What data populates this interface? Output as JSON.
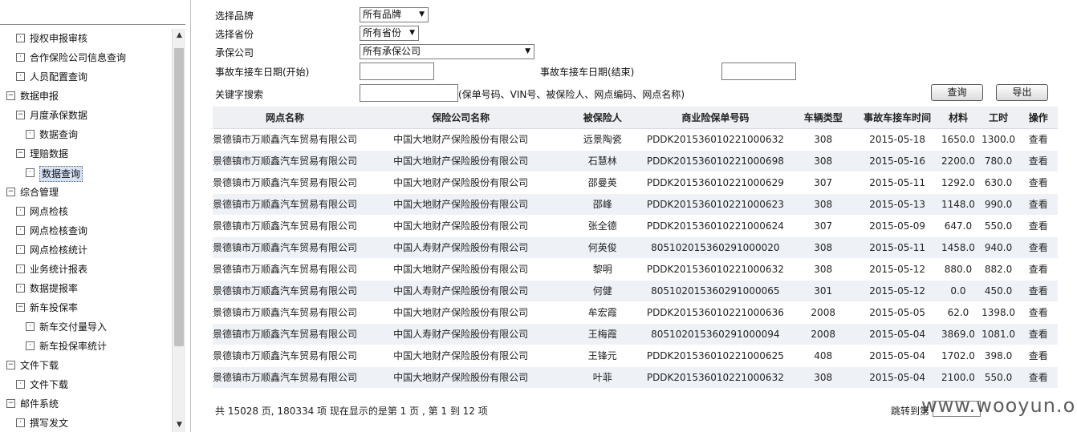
{
  "tree": [
    {
      "label": "授权申报审核",
      "level": 2,
      "type": "leaf"
    },
    {
      "label": "合作保险公司信息查询",
      "level": 2,
      "type": "leaf"
    },
    {
      "label": "人员配置查询",
      "level": 2,
      "type": "leaf"
    },
    {
      "label": "数据申报",
      "level": 1,
      "type": "open"
    },
    {
      "label": "月度承保数据",
      "level": 2,
      "type": "open"
    },
    {
      "label": "数据查询",
      "level": 3,
      "type": "leaf"
    },
    {
      "label": "理赔数据",
      "level": 2,
      "type": "open"
    },
    {
      "label": "数据查询",
      "level": 3,
      "type": "leaf",
      "selected": true
    },
    {
      "label": "综合管理",
      "level": 1,
      "type": "open"
    },
    {
      "label": "网点检核",
      "level": 2,
      "type": "leaf"
    },
    {
      "label": "网点检核查询",
      "level": 2,
      "type": "leaf"
    },
    {
      "label": "网点检核统计",
      "level": 2,
      "type": "leaf"
    },
    {
      "label": "业务统计报表",
      "level": 2,
      "type": "leaf"
    },
    {
      "label": "数据提报率",
      "level": 2,
      "type": "leaf"
    },
    {
      "label": "新车投保率",
      "level": 2,
      "type": "open"
    },
    {
      "label": "新车交付量导入",
      "level": 3,
      "type": "leaf"
    },
    {
      "label": "新车投保率统计",
      "level": 3,
      "type": "leaf"
    },
    {
      "label": "文件下载",
      "level": 1,
      "type": "open"
    },
    {
      "label": "文件下载",
      "level": 2,
      "type": "leaf"
    },
    {
      "label": "邮件系统",
      "level": 1,
      "type": "open"
    },
    {
      "label": "撰写发文",
      "level": 2,
      "type": "leaf"
    }
  ],
  "filters": {
    "brand_label": "选择品牌",
    "brand_value": "所有品牌",
    "province_label": "选择省份",
    "province_value": "所有省份",
    "insurer_label": "承保公司",
    "insurer_value": "所有承保公司",
    "date_start_label": "事故车接车日期(开始)",
    "date_end_label": "事故车接车日期(结束)",
    "keyword_label": "关键字搜索",
    "keyword_hint": "(保单号码、VIN号、被保险人、网点编码、网点名称)",
    "query_button": "查询",
    "export_button": "导出"
  },
  "table": {
    "headers": [
      "网点名称",
      "保险公司名称",
      "被保险人",
      "商业险保单号码",
      "车辆类型",
      "事故车接车时间",
      "材料",
      "工时",
      "操作"
    ],
    "rows": [
      [
        "景德镇市万顺鑫汽车贸易有限公司",
        "中国大地财产保险股份有限公司",
        "远景陶瓷",
        "PDDK201536010221000632",
        "308",
        "2015-05-18",
        "1650.0",
        "1300.0",
        "查看"
      ],
      [
        "景德镇市万顺鑫汽车贸易有限公司",
        "中国大地财产保险股份有限公司",
        "石慧林",
        "PDDK201536010221000698",
        "308",
        "2015-05-16",
        "2200.0",
        "780.0",
        "查看"
      ],
      [
        "景德镇市万顺鑫汽车贸易有限公司",
        "中国大地财产保险股份有限公司",
        "邵曼英",
        "PDDK201536010221000629",
        "307",
        "2015-05-11",
        "1292.0",
        "630.0",
        "查看"
      ],
      [
        "景德镇市万顺鑫汽车贸易有限公司",
        "中国大地财产保险股份有限公司",
        "邵峰",
        "PDDK201536010221000623",
        "308",
        "2015-05-13",
        "1148.0",
        "990.0",
        "查看"
      ],
      [
        "景德镇市万顺鑫汽车贸易有限公司",
        "中国大地财产保险股份有限公司",
        "张全德",
        "PDDK201536010221000624",
        "307",
        "2015-05-09",
        "647.0",
        "550.0",
        "查看"
      ],
      [
        "景德镇市万顺鑫汽车贸易有限公司",
        "中国人寿财产保险股份有限公司",
        "何英俊",
        "805102015360291000020",
        "308",
        "2015-05-11",
        "1458.0",
        "940.0",
        "查看"
      ],
      [
        "景德镇市万顺鑫汽车贸易有限公司",
        "中国大地财产保险股份有限公司",
        "黎明",
        "PDDK201536010221000632",
        "308",
        "2015-05-12",
        "880.0",
        "882.0",
        "查看"
      ],
      [
        "景德镇市万顺鑫汽车贸易有限公司",
        "中国人寿财产保险股份有限公司",
        "何健",
        "805102015360291000065",
        "301",
        "2015-05-12",
        "0.0",
        "450.0",
        "查看"
      ],
      [
        "景德镇市万顺鑫汽车贸易有限公司",
        "中国大地财产保险股份有限公司",
        "牟宏霞",
        "PDDK201536010221000636",
        "2008",
        "2015-05-05",
        "62.0",
        "1398.0",
        "查看"
      ],
      [
        "景德镇市万顺鑫汽车贸易有限公司",
        "中国人寿财产保险股份有限公司",
        "王梅霞",
        "805102015360291000094",
        "2008",
        "2015-05-04",
        "3869.0",
        "1081.0",
        "查看"
      ],
      [
        "景德镇市万顺鑫汽车贸易有限公司",
        "中国大地财产保险股份有限公司",
        "王锋元",
        "PDDK201536010221000625",
        "408",
        "2015-05-04",
        "1702.0",
        "398.0",
        "查看"
      ],
      [
        "景德镇市万顺鑫汽车贸易有限公司",
        "中国大地财产保险股份有限公司",
        "叶菲",
        "PDDK201536010221000632",
        "308",
        "2015-05-04",
        "2100.0",
        "550.0",
        "查看"
      ]
    ]
  },
  "pager": {
    "summary": "共 15028 页, 180334 项    现在显示的是第 1 页 , 第 1 到 12 项",
    "jump_label": "跳转到第"
  },
  "watermark": "www.wooyun.org"
}
